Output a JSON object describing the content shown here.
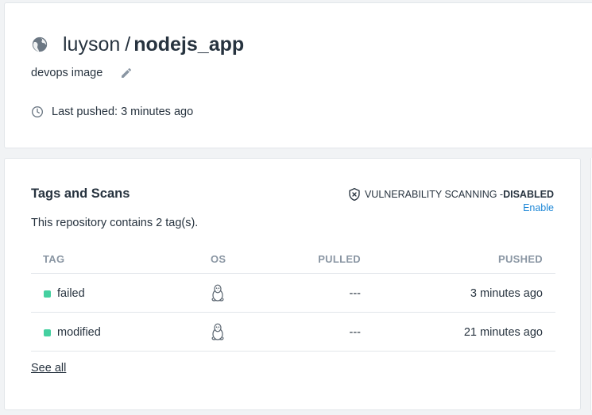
{
  "repo": {
    "namespace": "luyson",
    "separator": "/",
    "name": "nodejs_app",
    "description": "devops image",
    "last_pushed": "Last pushed: 3 minutes ago",
    "visibility_icon": "globe-icon"
  },
  "tags_section": {
    "title": "Tags and Scans",
    "scan_label": "VULNERABILITY SCANNING - ",
    "scan_status": "DISABLED",
    "enable_label": "Enable",
    "tag_count_text": "This repository contains 2 tag(s).",
    "columns": {
      "tag": "TAG",
      "os": "OS",
      "pulled": "PULLED",
      "pushed": "PUSHED"
    },
    "rows": [
      {
        "tag": "failed",
        "os_icon": "linux-icon",
        "pulled": "---",
        "pushed": "3 minutes ago"
      },
      {
        "tag": "modified",
        "os_icon": "linux-icon",
        "pulled": "---",
        "pushed": "21 minutes ago"
      }
    ],
    "see_all": "See all"
  },
  "colors": {
    "status_dot": "#45d0a0",
    "link": "#1f88d7",
    "header_text": "#8a96a3",
    "text": "#27333f"
  }
}
